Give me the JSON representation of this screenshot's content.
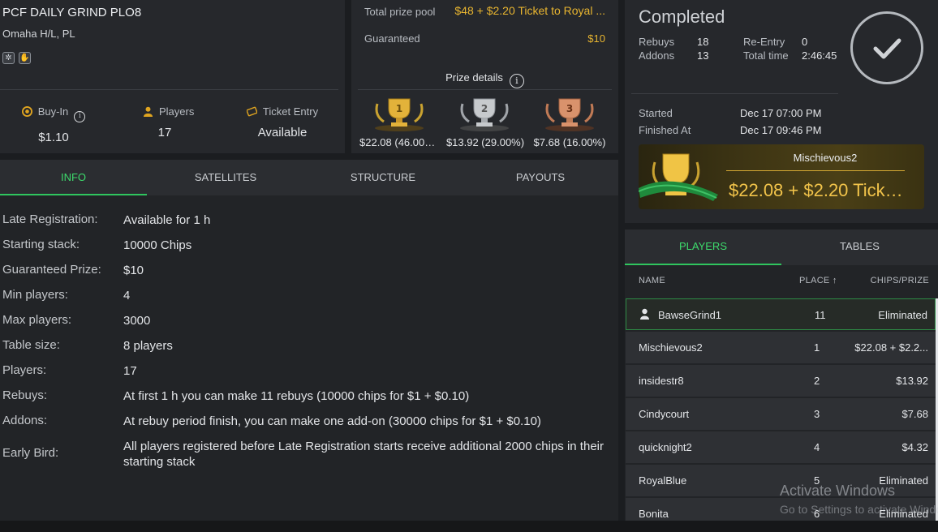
{
  "tournament": {
    "title": "PCF DAILY GRIND PLO8",
    "subtitle": "Omaha H/L, PL",
    "game_icons": [
      "settings-badge-icon",
      "hand-badge-icon"
    ]
  },
  "stats": {
    "buyin_label": "Buy-In",
    "buyin_value": "$1.10",
    "players_label": "Players",
    "players_value": "17",
    "ticket_label": "Ticket Entry",
    "ticket_value": "Available"
  },
  "prize": {
    "total_label": "Total prize pool",
    "total_value": "$48 + $2.20 Ticket to Royal ...",
    "guaranteed_label": "Guaranteed",
    "guaranteed_value": "$10",
    "details_label": "Prize details",
    "places": [
      {
        "rank": "1",
        "amount": "$22.08 (46.00%..."
      },
      {
        "rank": "2",
        "amount": "$13.92 (29.00%)"
      },
      {
        "rank": "3",
        "amount": "$7.68 (16.00%)"
      }
    ]
  },
  "status": {
    "title": "Completed",
    "rebuys_label": "Rebuys",
    "rebuys_value": "18",
    "addons_label": "Addons",
    "addons_value": "13",
    "reentry_label": "Re-Entry",
    "reentry_value": "0",
    "totaltime_label": "Total time",
    "totaltime_value": "2:46:45",
    "started_label": "Started",
    "started_value": "Dec 17 07:00 PM",
    "finished_label": "Finished At",
    "finished_value": "Dec 17 09:46 PM",
    "winner_name": "Mischievous2",
    "winner_prize": "$22.08 + $2.20 Ticke..."
  },
  "tabs": [
    "INFO",
    "SATELLITES",
    "STRUCTURE",
    "PAYOUTS"
  ],
  "info": [
    {
      "key": "Late Registration:",
      "value": "Available for 1 h"
    },
    {
      "key": "Starting stack:",
      "value": "10000 Chips"
    },
    {
      "key": "Guaranteed Prize:",
      "value": "$10"
    },
    {
      "key": "Min players:",
      "value": "4"
    },
    {
      "key": "Max players:",
      "value": "3000"
    },
    {
      "key": "Table size:",
      "value": "8 players"
    },
    {
      "key": "Players:",
      "value": "17"
    },
    {
      "key": "Rebuys:",
      "value": "At first 1 h you can make 11 rebuys (10000 chips for $1 + $0.10)"
    },
    {
      "key": "Addons:",
      "value": "At rebuy period finish, you can make one add-on (30000 chips for $1 + $0.10)"
    },
    {
      "key": "Early Bird:",
      "value": "All players registered before Late Registration starts receive additional 2000 chips in their starting stack"
    }
  ],
  "players_tabs": [
    "PLAYERS",
    "TABLES"
  ],
  "players_headers": {
    "name": "NAME",
    "place": "PLACE ↑",
    "chips": "CHIPS/PRIZE"
  },
  "players": [
    {
      "name": "BawseGrind1",
      "place": "11",
      "chips": "Eliminated"
    },
    {
      "name": "Mischievous2",
      "place": "1",
      "chips": "$22.08 + $2.2..."
    },
    {
      "name": "insidestr8",
      "place": "2",
      "chips": "$13.92"
    },
    {
      "name": "Cindycourt",
      "place": "3",
      "chips": "$7.68"
    },
    {
      "name": "quicknight2",
      "place": "4",
      "chips": "$4.32"
    },
    {
      "name": "RoyalBlue",
      "place": "5",
      "chips": "Eliminated"
    },
    {
      "name": "Bonita",
      "place": "6",
      "chips": "Eliminated"
    }
  ],
  "watermark": {
    "line1": "Activate Windows",
    "line2": "Go to Settings to activate Windows."
  },
  "colors": {
    "accent_green": "#2fc55e",
    "gold": "#e8b530",
    "panel": "#26282c"
  }
}
